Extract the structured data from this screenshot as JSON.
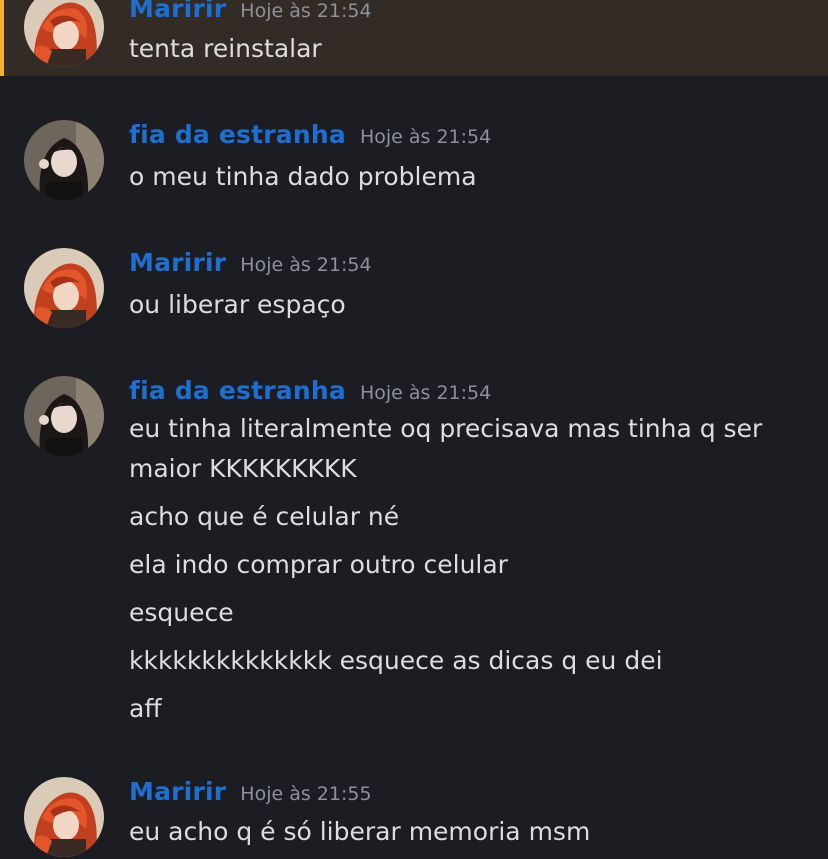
{
  "colors": {
    "background": "#1c1d22",
    "highlight_background": "#332b25",
    "highlight_bar": "#f0b232",
    "author_name": "#1f6fd0",
    "timestamp": "#8e9198",
    "message_text": "#dcdde1"
  },
  "messages": [
    {
      "author": "Maririr",
      "timestamp": "Hoje às 21:54",
      "avatar": "avatar-red-haired-character",
      "highlighted": true,
      "lines": [
        "tenta reinstalar"
      ]
    },
    {
      "author": "fia da estranha",
      "timestamp": "Hoje às 21:54",
      "avatar": "avatar-dark-haired-girl",
      "highlighted": false,
      "lines": [
        "o meu tinha dado problema"
      ]
    },
    {
      "author": "Maririr",
      "timestamp": "Hoje às 21:54",
      "avatar": "avatar-red-haired-character",
      "highlighted": false,
      "lines": [
        "ou liberar espaço"
      ]
    },
    {
      "author": "fia da estranha",
      "timestamp": "Hoje às 21:54",
      "avatar": "avatar-dark-haired-girl",
      "highlighted": false,
      "lines": [
        "eu tinha literalmente oq precisava mas tinha q ser",
        "maior KKKKKKKKK",
        "acho que é celular né",
        "ela indo comprar outro celular",
        "esquece",
        "kkkkkkkkkkkkkk esquece as dicas q eu dei",
        "aff"
      ]
    },
    {
      "author": "Maririr",
      "timestamp": "Hoje às 21:55",
      "avatar": "avatar-red-haired-character",
      "highlighted": false,
      "lines": [
        "eu acho q é só liberar memoria msm"
      ]
    }
  ]
}
